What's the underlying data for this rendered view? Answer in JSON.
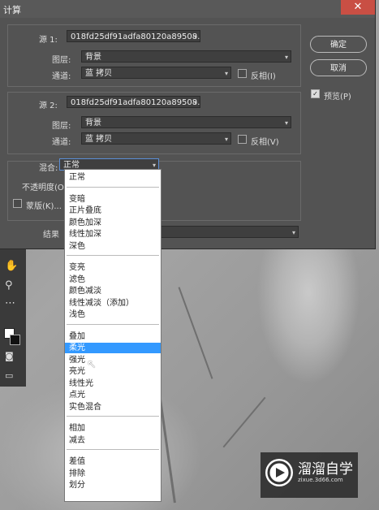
{
  "dialog": {
    "title": "计算",
    "close_icon": "✕",
    "source1": {
      "label": "源 1:",
      "file": "018fd25df91adfa80120a89508…",
      "layer_label": "图层:",
      "layer_value": "背景",
      "channel_label": "通道:",
      "channel_value": "蓝 拷贝",
      "invert_label": "反相(I)"
    },
    "source2": {
      "label": "源 2:",
      "file": "018fd25df91adfa80120a89508…",
      "layer_label": "图层:",
      "layer_value": "背景",
      "channel_label": "通道:",
      "channel_value": "蓝 拷贝",
      "invert_label": "反相(V)"
    },
    "blend_label": "混合:",
    "blend_value": "正常",
    "opacity_label": "不透明度(O",
    "mask_label": "蒙版(K)...",
    "result_label": "结果",
    "ok_label": "确定",
    "cancel_label": "取消",
    "preview_label": "预览(P)",
    "preview_checked": true
  },
  "blend_modes": {
    "groups": [
      [
        "正常"
      ],
      [
        "变暗",
        "正片叠底",
        "颜色加深",
        "线性加深",
        "深色"
      ],
      [
        "变亮",
        "滤色",
        "颜色减淡",
        "线性减淡（添加）",
        "浅色"
      ],
      [
        "叠加",
        "柔光",
        "强光",
        "亮光",
        "线性光",
        "点光",
        "实色混合"
      ],
      [
        "相加",
        "减去"
      ],
      [
        "差值",
        "排除",
        "划分"
      ]
    ],
    "highlighted": "柔光"
  },
  "watermark": {
    "brand": "溜溜自学",
    "url": "zixue.3d66.com"
  }
}
